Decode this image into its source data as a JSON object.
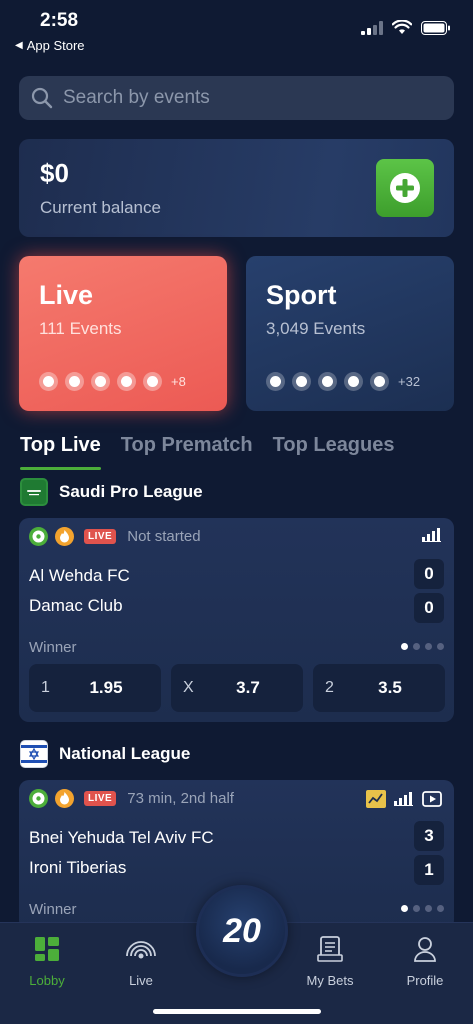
{
  "status": {
    "time": "2:58",
    "back_label": "App Store"
  },
  "search": {
    "placeholder": "Search by events"
  },
  "balance": {
    "amount": "$0",
    "label": "Current balance"
  },
  "categories": [
    {
      "title": "Live",
      "events": "111 Events",
      "more": "+8"
    },
    {
      "title": "Sport",
      "events": "3,049 Events",
      "more": "+32"
    }
  ],
  "tabs": [
    "Top Live",
    "Top Prematch",
    "Top Leagues"
  ],
  "leagues": [
    {
      "name": "Saudi Pro League",
      "match": {
        "badge": "LIVE",
        "status": "Not started",
        "team1": "Al Wehda FC",
        "team2": "Damac Club",
        "score1": "0",
        "score2": "0",
        "market": "Winner",
        "odds": [
          {
            "label": "1",
            "value": "1.95"
          },
          {
            "label": "X",
            "value": "3.7"
          },
          {
            "label": "2",
            "value": "3.5"
          }
        ]
      }
    },
    {
      "name": "National League",
      "match": {
        "badge": "LIVE",
        "status": "73 min, 2nd half",
        "team1": "Bnei Yehuda Tel Aviv FC",
        "team2": "Ironi Tiberias",
        "score1": "3",
        "score2": "1",
        "market": "Winner"
      }
    }
  ],
  "nav": {
    "lobby": "Lobby",
    "live": "Live",
    "center": "20",
    "bets": "My Bets",
    "profile": "Profile"
  },
  "colors": {
    "background": "#0f1a33",
    "accent_green": "#4cae3a",
    "live_red": "#ec5a54",
    "card_blue": "#223359"
  }
}
